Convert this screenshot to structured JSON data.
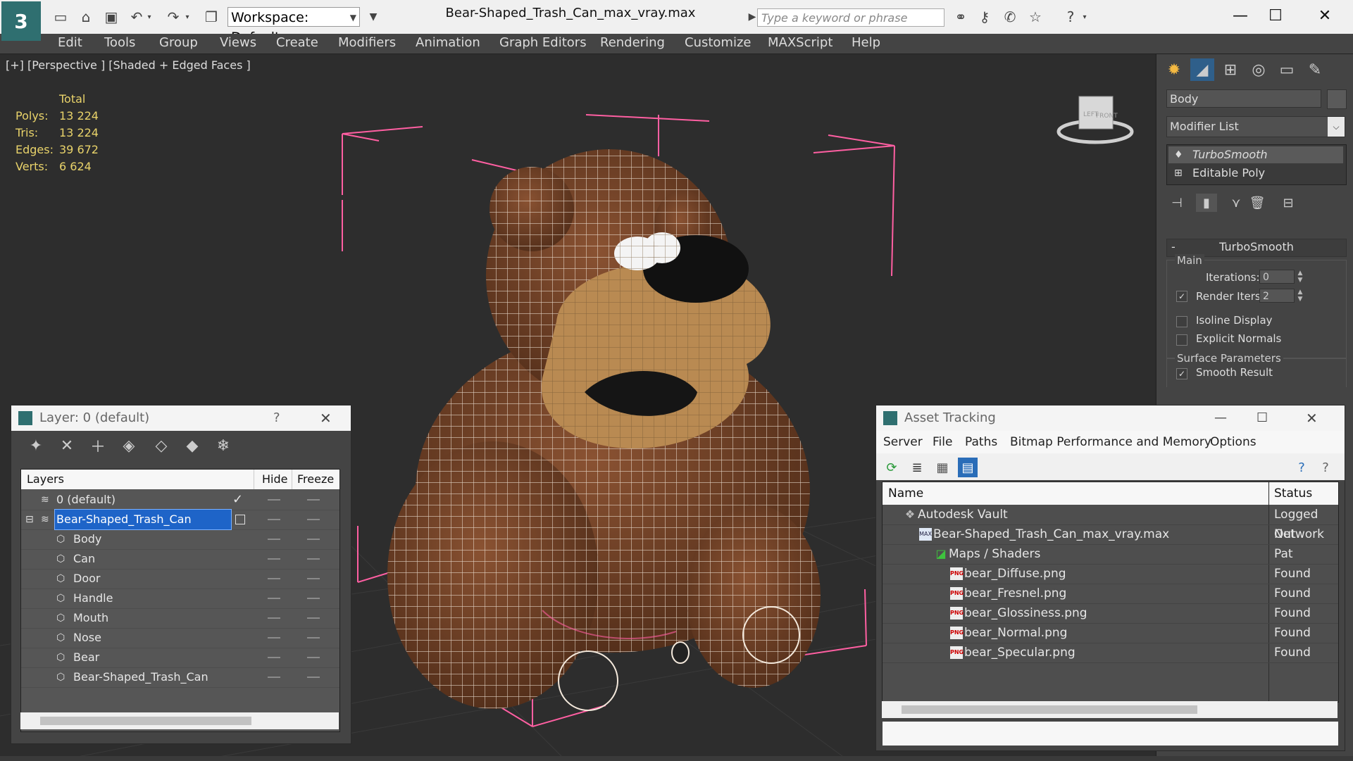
{
  "app": {
    "file_title": "Bear-Shaped_Trash_Can_max_vray.max",
    "workspace": "Workspace: Default",
    "search_placeholder": "Type a keyword or phrase"
  },
  "menu": [
    "Edit",
    "Tools",
    "Group",
    "Views",
    "Create",
    "Modifiers",
    "Animation",
    "Graph Editors",
    "Rendering",
    "Customize",
    "MAXScript",
    "Help"
  ],
  "viewport": {
    "label": "[+] [Perspective ] [Shaded + Edged Faces ]",
    "stats_header": "Total",
    "stats": [
      {
        "label": "Polys:",
        "value": "13 224"
      },
      {
        "label": "Tris:",
        "value": "13 224"
      },
      {
        "label": "Edges:",
        "value": "39 672"
      },
      {
        "label": "Verts:",
        "value": "6 624"
      }
    ],
    "viewcube_labels": [
      "LEFT",
      "FRONT"
    ]
  },
  "command_panel": {
    "object_name": "Body",
    "modifier_list": "Modifier List",
    "stack": [
      "TurboSmooth",
      "Editable Poly"
    ],
    "rollout_title": "TurboSmooth",
    "main_label": "Main",
    "iterations_label": "Iterations:",
    "iterations_value": "0",
    "render_iters_label": "Render Iters:",
    "render_iters_value": "2",
    "isoline_label": "Isoline Display",
    "explicit_normals_label": "Explicit Normals",
    "surface_params_label": "Surface Parameters",
    "smooth_result_label": "Smooth Result"
  },
  "layer_dialog": {
    "title": "Layer: 0 (default)",
    "help": "?",
    "columns": [
      "Layers",
      "Hide",
      "Freeze"
    ],
    "rows": [
      {
        "name": "0 (default)"
      },
      {
        "name": "Bear-Shaped_Trash_Can"
      },
      {
        "name": "Body"
      },
      {
        "name": "Can"
      },
      {
        "name": "Door"
      },
      {
        "name": "Handle"
      },
      {
        "name": "Mouth"
      },
      {
        "name": "Nose"
      },
      {
        "name": "Bear"
      },
      {
        "name": "Bear-Shaped_Trash_Can"
      }
    ]
  },
  "asset_dialog": {
    "title": "Asset Tracking",
    "menu": [
      "Server",
      "File",
      "Paths",
      "Bitmap Performance and Memory",
      "Options"
    ],
    "columns": [
      "Name",
      "Status"
    ],
    "rows": [
      {
        "name": "Autodesk Vault",
        "status": "Logged Out"
      },
      {
        "name": "Bear-Shaped_Trash_Can_max_vray.max",
        "status": "Network Pat"
      },
      {
        "name": "Maps / Shaders",
        "status": ""
      },
      {
        "name": "bear_Diffuse.png",
        "status": "Found"
      },
      {
        "name": "bear_Fresnel.png",
        "status": "Found"
      },
      {
        "name": "bear_Glossiness.png",
        "status": "Found"
      },
      {
        "name": "bear_Normal.png",
        "status": "Found"
      },
      {
        "name": "bear_Specular.png",
        "status": "Found"
      }
    ]
  },
  "colors": {
    "selection": "#1e64c8",
    "stats_text": "#e9d36a",
    "model_brown": "#6e4126",
    "model_tan": "#b98a52",
    "bbox_pink": "#ff5fa2"
  }
}
